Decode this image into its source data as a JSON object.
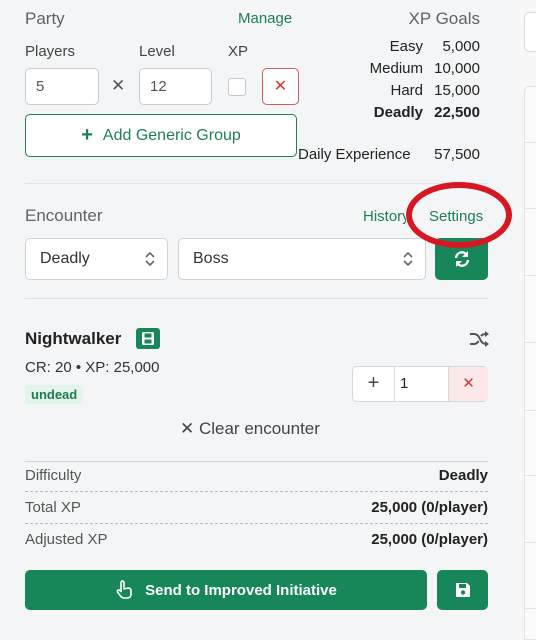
{
  "party": {
    "title": "Party",
    "manage_label": "Manage",
    "players_label": "Players",
    "level_label": "Level",
    "xp_label": "XP",
    "players_value": "5",
    "level_value": "12",
    "multiply_symbol": "✕",
    "remove_symbol": "✕",
    "add_group_label": "Add Generic Group",
    "add_symbol": "+"
  },
  "xp_goals": {
    "title": "XP Goals",
    "rows": [
      {
        "label": "Easy",
        "value": "5,000"
      },
      {
        "label": "Medium",
        "value": "10,000"
      },
      {
        "label": "Hard",
        "value": "15,000"
      },
      {
        "label": "Deadly",
        "value": "22,500"
      }
    ],
    "daily_label": "Daily Experience",
    "daily_value": "57,500"
  },
  "encounter": {
    "title": "Encounter",
    "history_label": "History",
    "settings_label": "Settings",
    "difficulty_select": "Deadly",
    "type_select": "Boss"
  },
  "monster": {
    "name": "Nightwalker",
    "stats": "CR: 20 • XP: 25,000",
    "tag": "undead",
    "count": "1",
    "plus_symbol": "+",
    "remove_symbol": "✕"
  },
  "clear_label": "✕ Clear encounter",
  "summary": {
    "rows": [
      {
        "label": "Difficulty",
        "value": "Deadly"
      },
      {
        "label": "Total XP",
        "value": "25,000 (0/player)"
      },
      {
        "label": "Adjusted XP",
        "value": "25,000 (0/player)"
      }
    ]
  },
  "actions": {
    "send_label": "Send to Improved Initiative"
  },
  "colors": {
    "accent_green": "#17875a",
    "danger_red": "#d33",
    "annotation_red": "#d71822"
  },
  "icons": [
    "plus-icon",
    "times-icon",
    "save-icon",
    "refresh-icon",
    "shuffle-icon",
    "hand-icon",
    "caret-updown-icon",
    "floppy-badge-icon"
  ]
}
